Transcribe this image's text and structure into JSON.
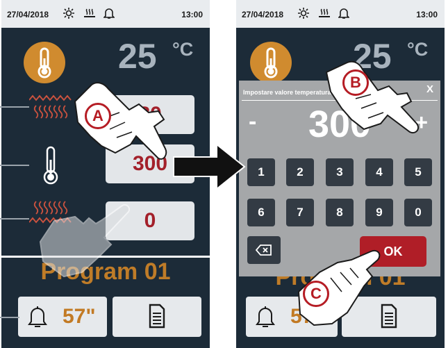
{
  "left_screen": {
    "status": {
      "date": "27/04/2018",
      "time": "13:00"
    },
    "temperature": {
      "value": "25",
      "unit": "°C"
    },
    "settings": [
      {
        "value": "80"
      },
      {
        "value": "300"
      },
      {
        "value": "0"
      }
    ],
    "program_name": "Program 01",
    "timer": "57\""
  },
  "right_screen": {
    "status": {
      "date": "27/04/2018",
      "time": "13:00"
    },
    "temperature": {
      "value": "25",
      "unit": "°C"
    },
    "program_name": "Program 01",
    "timer": "57\"",
    "dialog": {
      "title": "Impostare valore temperatura",
      "close": "X",
      "minus": "-",
      "plus": "+",
      "value": "300",
      "keys_row1": [
        "1",
        "2",
        "3",
        "4",
        "5"
      ],
      "keys_row2": [
        "6",
        "7",
        "8",
        "9",
        "0"
      ],
      "ok": "OK"
    }
  },
  "callouts": {
    "a": "A",
    "b": "B",
    "c": "C"
  },
  "colors": {
    "screen_bg": "#1c2b38",
    "accent_orange": "#c27a24",
    "value_red": "#a3202a",
    "ok_red": "#b01e27",
    "callout_red": "#b51c24"
  },
  "icons": [
    "clean-icon",
    "steam-icon",
    "bell-icon",
    "thermometer-icon",
    "heat-top-icon",
    "heat-bottom-icon",
    "document-icon",
    "backspace-icon",
    "hand-pointer-icon",
    "arrow-right-icon"
  ]
}
